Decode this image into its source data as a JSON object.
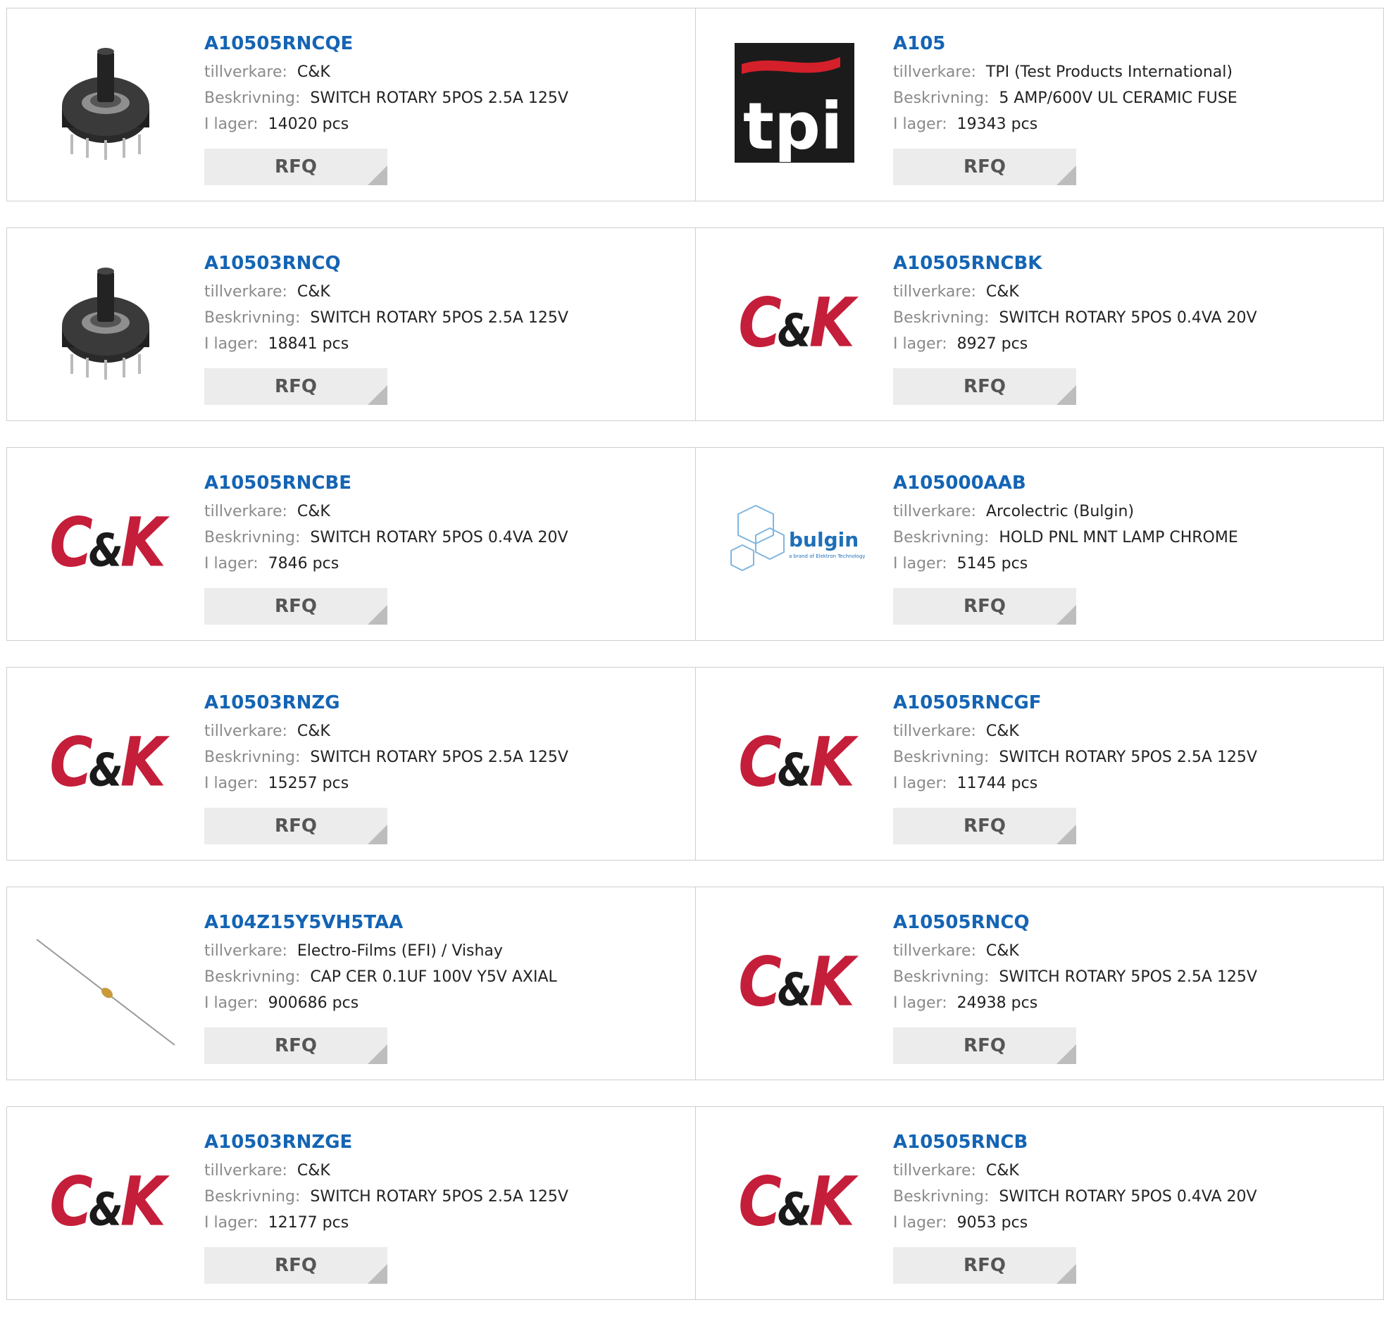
{
  "labels": {
    "manufacturer": "tillverkare:",
    "description": "Beskrivning:",
    "stock": "I lager:",
    "rfq": "RFQ"
  },
  "products": [
    {
      "part": "A10505RNCQE",
      "manufacturer": "C&K",
      "description": "SWITCH ROTARY 5POS 2.5A 125V",
      "stock": "14020 pcs",
      "image": "rotary-switch-photo"
    },
    {
      "part": "A105",
      "manufacturer": "TPI (Test Products International)",
      "description": "5 AMP/600V UL CERAMIC FUSE",
      "stock": "19343 pcs",
      "image": "tpi-logo",
      "logo_text": "tpi"
    },
    {
      "part": "A10503RNCQ",
      "manufacturer": "C&K",
      "description": "SWITCH ROTARY 5POS 2.5A 125V",
      "stock": "18841 pcs",
      "image": "rotary-switch-photo"
    },
    {
      "part": "A10505RNCBK",
      "manufacturer": "C&K",
      "description": "SWITCH ROTARY 5POS 0.4VA 20V",
      "stock": "8927 pcs",
      "image": "ck-logo"
    },
    {
      "part": "A10505RNCBE",
      "manufacturer": "C&K",
      "description": "SWITCH ROTARY 5POS 0.4VA 20V",
      "stock": "7846 pcs",
      "image": "ck-logo"
    },
    {
      "part": "A105000AAB",
      "manufacturer": "Arcolectric (Bulgin)",
      "description": "HOLD PNL MNT LAMP CHROME",
      "stock": "5145 pcs",
      "image": "bulgin-logo",
      "logo_text": "bulgin",
      "logo_subtext": "a brand of Elektron Technology"
    },
    {
      "part": "A10503RNZG",
      "manufacturer": "C&K",
      "description": "SWITCH ROTARY 5POS 2.5A 125V",
      "stock": "15257 pcs",
      "image": "ck-logo"
    },
    {
      "part": "A10505RNCGF",
      "manufacturer": "C&K",
      "description": "SWITCH ROTARY 5POS 2.5A 125V",
      "stock": "11744 pcs",
      "image": "ck-logo"
    },
    {
      "part": "A104Z15Y5VH5TAA",
      "manufacturer": "Electro-Films (EFI) / Vishay",
      "description": "CAP CER 0.1UF 100V Y5V AXIAL",
      "stock": "900686 pcs",
      "image": "axial-capacitor-photo"
    },
    {
      "part": "A10505RNCQ",
      "manufacturer": "C&K",
      "description": "SWITCH ROTARY 5POS 2.5A 125V",
      "stock": "24938 pcs",
      "image": "ck-logo"
    },
    {
      "part": "A10503RNZGE",
      "manufacturer": "C&K",
      "description": "SWITCH ROTARY 5POS 2.5A 125V",
      "stock": "12177 pcs",
      "image": "ck-logo"
    },
    {
      "part": "A10505RNCB",
      "manufacturer": "C&K",
      "description": "SWITCH ROTARY 5POS 0.4VA 20V",
      "stock": "9053 pcs",
      "image": "ck-logo"
    }
  ],
  "colors": {
    "part_link": "#1464b4",
    "ck_red": "#c41e3a",
    "label_gray": "#8a8a8a",
    "button_bg": "#ececec",
    "border": "#cfcfcf"
  }
}
